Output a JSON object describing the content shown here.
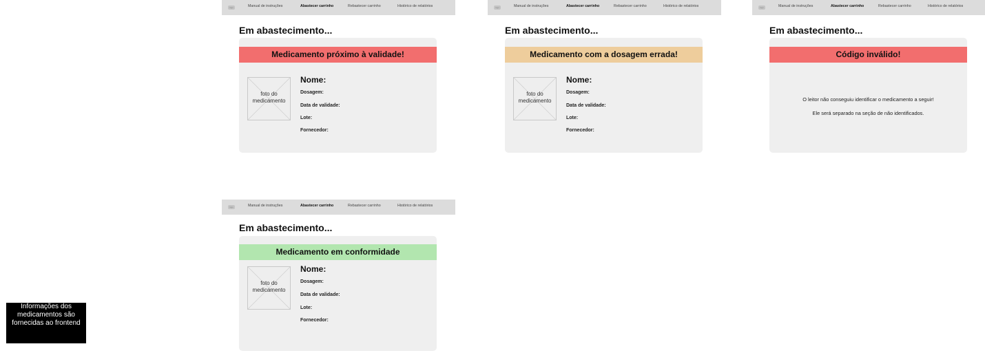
{
  "nav": {
    "logo": "logo",
    "items": [
      "Manual de instruções",
      "Abastecer carrinho",
      "Rebastecer carrinho",
      "Histórico de relatórios"
    ],
    "active_index": 1
  },
  "screens": [
    {
      "heading": "Em abastecimento...",
      "banner": "Medicamento próximo à validade!",
      "banner_color": "#f26e6e",
      "photo_label": "foto do medicamento",
      "fields": {
        "name": "Nome:",
        "dosage": "Dosagem:",
        "expiry": "Data de validade:",
        "batch": "Lote:",
        "supplier": "Fornecedor:"
      }
    },
    {
      "heading": "Em abastecimento...",
      "banner": "Medicamento com a dosagem errada!",
      "banner_color": "#eecd9c",
      "photo_label": "foto do medicamento",
      "fields": {
        "name": "Nome:",
        "dosage": "Dosagem:",
        "expiry": "Data de validade:",
        "batch": "Lote:",
        "supplier": "Fornecedor:"
      }
    },
    {
      "heading": "Em abastecimento...",
      "banner": "Código inválido!",
      "banner_color": "#f26e6e",
      "message_line1": "O leitor não conseguiu identificar o medicamento a seguir!",
      "message_line2": "Ele será separado na seção de não identificados."
    },
    {
      "heading": "Em abastecimento...",
      "banner": "Medicamento em conformidade",
      "banner_color": "#b2e6af",
      "photo_label": "foto do medicamento",
      "fields": {
        "name": "Nome:",
        "dosage": "Dosagem:",
        "expiry": "Data de validade:",
        "batch": "Lote:",
        "supplier": "Fornecedor:"
      }
    }
  ],
  "note": "Informações dos medicamentos são fornecidas ao frontend"
}
